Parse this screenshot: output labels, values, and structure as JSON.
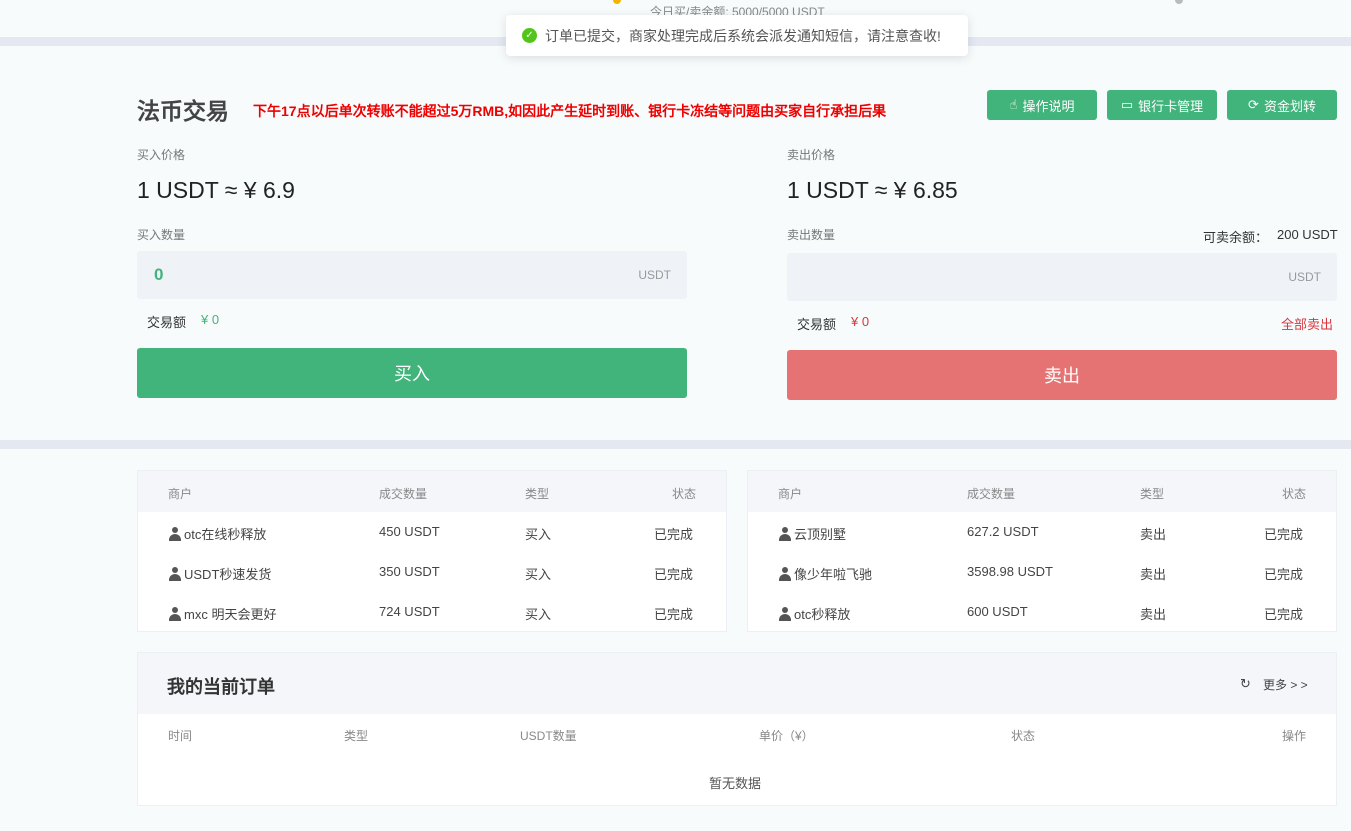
{
  "top": {
    "subtitle": "今日买/卖余额: 5000/5000 USDT"
  },
  "toast": {
    "icon": "check-circle-icon",
    "message": "订单已提交，商家处理完成后系统会派发通知短信，请注意查收!"
  },
  "header": {
    "title": "法币交易",
    "notice": "下午17点以后单次转账不能超过5万RMB,如因此产生延时到账、银行卡冻结等问题由买家自行承担后果",
    "buttons": [
      {
        "label": "操作说明",
        "icon": "hand-pointer-icon"
      },
      {
        "label": "银行卡管理",
        "icon": "credit-card-icon"
      },
      {
        "label": "资金划转",
        "icon": "transfer-icon"
      }
    ]
  },
  "buy": {
    "price_label": "买入价格",
    "price": "1 USDT ≈ ¥ 6.9",
    "qty_label": "买入数量",
    "qty_value": "0",
    "unit": "USDT",
    "amount_label": "交易额",
    "amount_value": "¥ 0",
    "button": "买入"
  },
  "sell": {
    "price_label": "卖出价格",
    "price": "1 USDT ≈ ¥ 6.85",
    "qty_label": "卖出数量",
    "balance_label": "可卖余额：",
    "balance_value": "200 USDT",
    "qty_value": "",
    "unit": "USDT",
    "amount_label": "交易额",
    "amount_value": "¥ 0",
    "sell_all": "全部卖出",
    "button": "卖出"
  },
  "trades_headers": [
    "商户",
    "成交数量",
    "类型",
    "状态"
  ],
  "buy_trades": [
    {
      "merchant": "otc在线秒释放",
      "qty": "450 USDT",
      "type": "买入",
      "status": "已完成"
    },
    {
      "merchant": "USDT秒速发货",
      "qty": "350 USDT",
      "type": "买入",
      "status": "已完成"
    },
    {
      "merchant": "mxc 明天会更好",
      "qty": "724 USDT",
      "type": "买入",
      "status": "已完成"
    }
  ],
  "sell_trades": [
    {
      "merchant": "云顶别墅",
      "qty": "627.2 USDT",
      "type": "卖出",
      "status": "已完成"
    },
    {
      "merchant": "像少年啦飞驰",
      "qty": "3598.98 USDT",
      "type": "卖出",
      "status": "已完成"
    },
    {
      "merchant": "otc秒释放",
      "qty": "600 USDT",
      "type": "卖出",
      "status": "已完成"
    }
  ],
  "orders": {
    "title": "我的当前订单",
    "more": "更多 > >",
    "refresh_icon": "refresh-icon",
    "columns": [
      "时间",
      "类型",
      "USDT数量",
      "单价（¥）",
      "状态",
      "操作"
    ],
    "empty": "暂无数据"
  },
  "colors": {
    "green": "#41b47c",
    "red": "#e57373",
    "notice": "#ee0000"
  }
}
